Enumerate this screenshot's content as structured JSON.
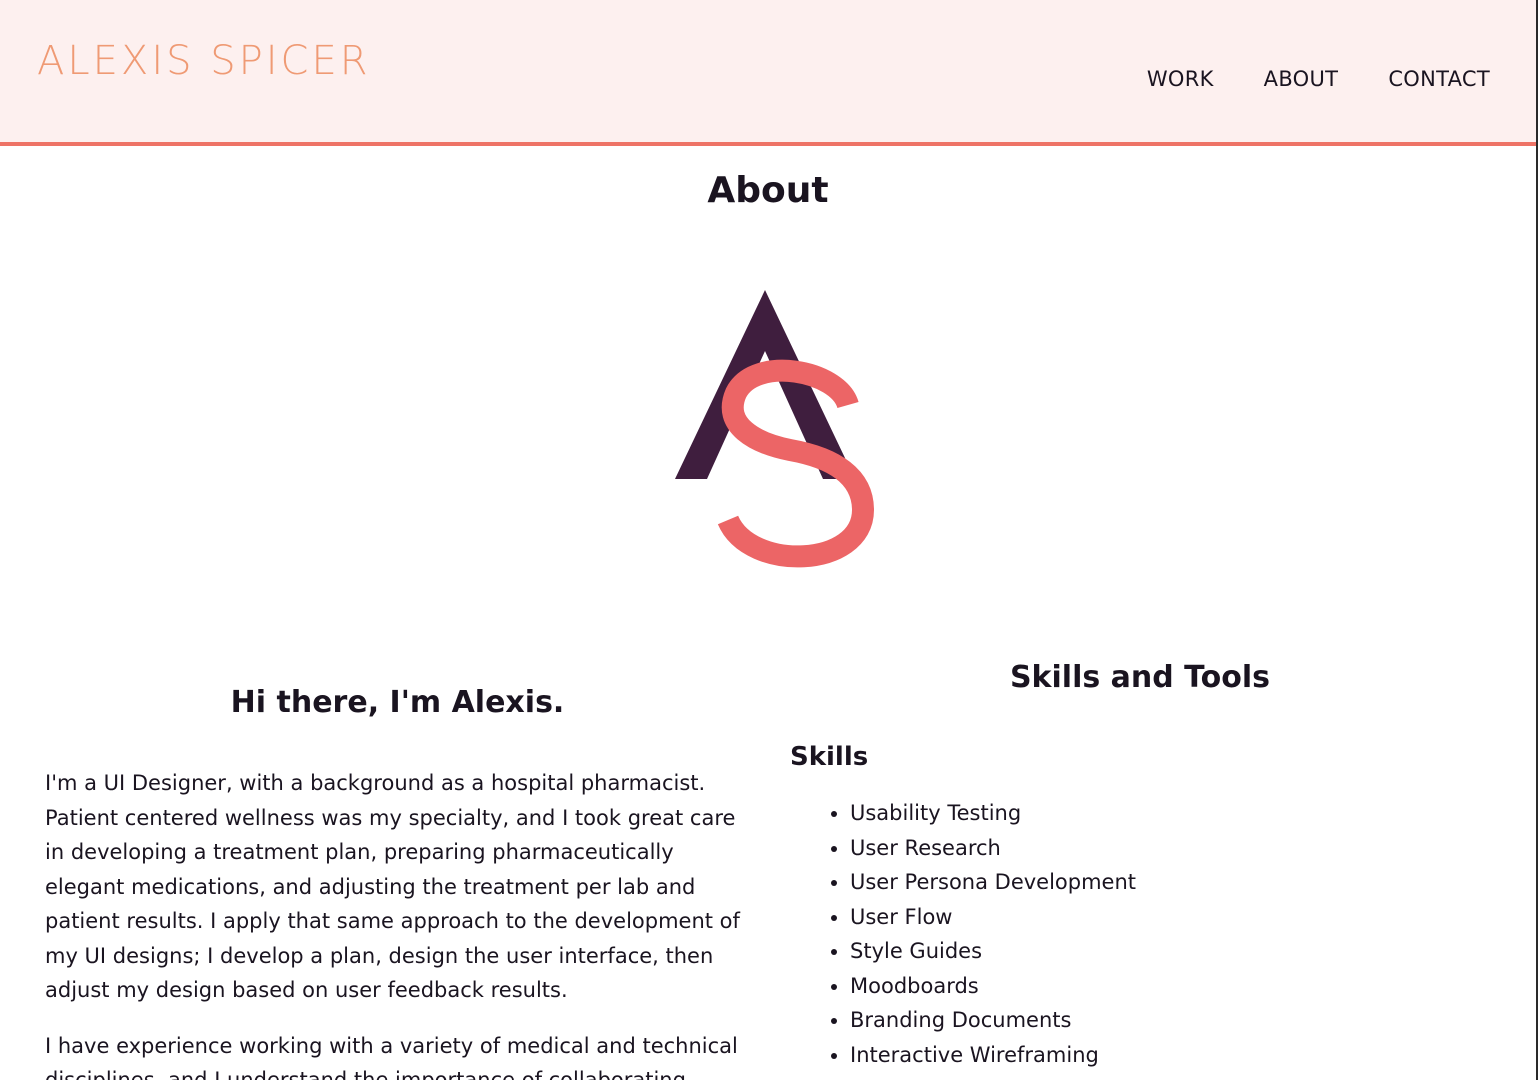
{
  "header": {
    "brand": "ALEXIS SPICER",
    "nav": [
      {
        "label": "WORK"
      },
      {
        "label": "ABOUT"
      },
      {
        "label": "CONTACT"
      }
    ]
  },
  "main": {
    "title": "About",
    "monogram": {
      "letter_a": "A",
      "letter_s": "S"
    },
    "intro": {
      "heading": "Hi there, I'm Alexis.",
      "paragraphs": [
        "I'm a UI Designer, with a background as a hospital pharmacist. Patient centered wellness was my specialty, and I took great care in developing a treatment plan, preparing pharmaceutically elegant medications, and adjusting the treatment per lab and patient results. I apply that same approach to the development of my UI designs; I develop a plan, design the user interface, then adjust my design based on user feedback results.",
        "I have experience working with a variety of medical and technical disciplines, and I understand the importance of collaborating"
      ]
    },
    "skills_tools": {
      "heading": "Skills and Tools",
      "skills_heading": "Skills",
      "skills": [
        "Usability Testing",
        "User Research",
        "User Persona Development",
        "User Flow",
        "Style Guides",
        "Moodboards",
        "Branding Documents",
        "Interactive Wireframing"
      ]
    }
  },
  "colors": {
    "header_bg": "#fdf0ef",
    "accent": "#ee7366",
    "brand": "#ef9a74",
    "monogram_a": "#3f1e3e",
    "monogram_s": "#ec6566",
    "text": "#1a1420"
  }
}
